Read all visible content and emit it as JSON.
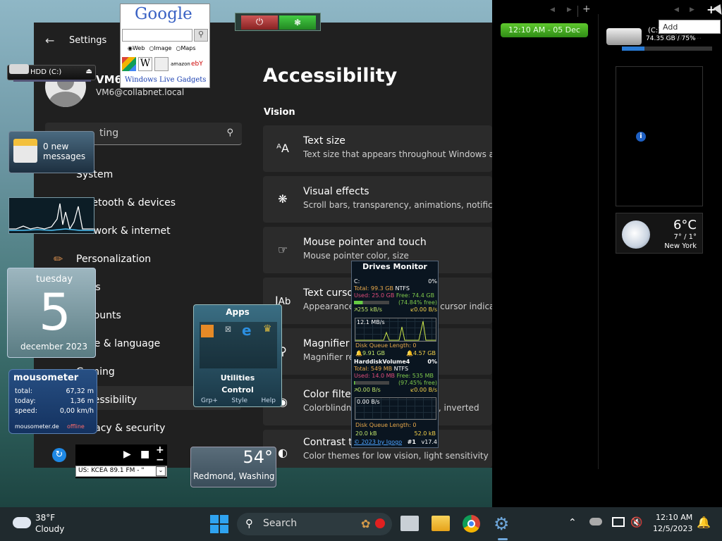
{
  "settings": {
    "title": "Settings",
    "user_name": "VM6",
    "user_email": "VM6@collabnet.local",
    "search_placeholder": "Find a setting",
    "search_visible": "ting",
    "nav": [
      {
        "label": "System"
      },
      {
        "label": "Bluetooth & devices"
      },
      {
        "label": "Network & internet"
      },
      {
        "label": "Personalization"
      },
      {
        "label": "Apps"
      },
      {
        "label": "Accounts"
      },
      {
        "label": "Time & language"
      },
      {
        "label": "Gaming"
      },
      {
        "label": "Accessibility"
      },
      {
        "label": "Privacy & security"
      }
    ],
    "page_title": "Accessibility",
    "section": "Vision",
    "cards": [
      {
        "title": "Text size",
        "desc": "Text size that appears throughout Windows and y"
      },
      {
        "title": "Visual effects",
        "desc": "Scroll bars, transparency, animations, notification"
      },
      {
        "title": "Mouse pointer and touch",
        "desc": "Mouse pointer color, size"
      },
      {
        "title": "Text cursor",
        "desc": "Appearance and thickness, text cursor indicator"
      },
      {
        "title": "Magnifier",
        "desc": "Magnifier reading"
      },
      {
        "title": "Color filters",
        "desc": "Colorblindness filters, grayscale, inverted"
      },
      {
        "title": "Contrast themes",
        "desc": "Color themes for low vision, light sensitivity"
      }
    ]
  },
  "google": {
    "logo": "Google",
    "opts": [
      "Web",
      "Image",
      "Maps"
    ],
    "link": "Windows Live Gadgets"
  },
  "hdd_left": {
    "label": "HDD (C:)"
  },
  "mail": {
    "count": "0 new",
    "label": "messages"
  },
  "calendar": {
    "day_name": "tuesday",
    "day": "5",
    "month_year": "december 2023"
  },
  "mousometer": {
    "title": "mousometer",
    "rows": [
      {
        "k": "total:",
        "v": "67,32 m"
      },
      {
        "k": "today:",
        "v": "1,36 m"
      },
      {
        "k": "speed:",
        "v": "0,00 km/h"
      }
    ],
    "site": "mousometer.de",
    "status": "offline"
  },
  "radio": {
    "station": "US: KCEA 89.1 FM - \""
  },
  "apps_gadget": {
    "title": "Apps",
    "group1": "Utilities",
    "group2": "Control",
    "footer": [
      "Grp+",
      "Style",
      "Help"
    ]
  },
  "weather_small": {
    "temp": "54°",
    "city": "Redmond, Washing"
  },
  "drives": {
    "title": "Drives Monitor",
    "c": {
      "name": "C:",
      "pct": "0%",
      "total": "Total: 99.3 GB",
      "fs": "NTFS",
      "used": "Used: 25.0 GB",
      "free": "Free: 74.4 GB",
      "freepct": "(74.84% free)",
      "up": "255 kB/s",
      "down": "0.00 B/s",
      "graph": "12.1 MB/s",
      "queue": "Disk Queue Length: 0",
      "r": "9.91 GB",
      "w": "4.57 GB"
    },
    "h": {
      "name": "HarddiskVolume4",
      "pct": "0%",
      "total": "Total: 549 MB",
      "fs": "NTFS",
      "used": "Used: 14.0 MB",
      "free": "Free: 535 MB",
      "freepct": "(97.45% free)",
      "up": "0.00 B/s",
      "down": "0.00 B/s",
      "graph": "0.00 B/s",
      "queue": "Disk Queue Length: 0",
      "r": "20.0 kB",
      "w": "52.0 kB"
    },
    "footer": "© 2023 by Igogo",
    "num": "#1",
    "ver": "v17.4"
  },
  "sidebar": {
    "clock": "12:10 AM - 05 Dec",
    "disk_label": "(C:)",
    "disk_info": "74.35 GB / 75%",
    "tooltip": "Add gadgets...",
    "weather": {
      "temp": "6°C",
      "range": "7° / 1°",
      "city": "New York"
    }
  },
  "taskbar": {
    "weather_temp": "38°F",
    "weather_desc": "Cloudy",
    "search": "Search",
    "time": "12:10 AM",
    "date": "12/5/2023"
  }
}
